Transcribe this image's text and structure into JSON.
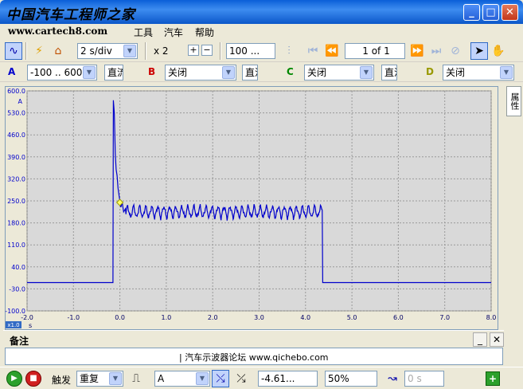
{
  "window": {
    "title": "中国汽车工程师之家",
    "min_label": "_",
    "max_label": "□",
    "close_label": "✕"
  },
  "menubar": {
    "watermark": "www.cartech8.com",
    "items": [
      "工具",
      "汽车",
      "帮助"
    ]
  },
  "toolbar": {
    "timebase": "2 s/div",
    "zoom": "x 2",
    "samples": "100 ...",
    "page": "1 of 1"
  },
  "channels": [
    {
      "letter": "A",
      "color": "#0000cc",
      "range": "-100 .. 600 A",
      "coupling": "直流"
    },
    {
      "letter": "B",
      "color": "#cc0000",
      "range": "关闭",
      "coupling": "直流"
    },
    {
      "letter": "C",
      "color": "#008800",
      "range": "关闭",
      "coupling": "直流"
    },
    {
      "letter": "D",
      "color": "#999900",
      "range": "关闭",
      "coupling": ""
    }
  ],
  "side_tab": "属性",
  "chart_data": {
    "type": "line",
    "y_unit": "A",
    "x_unit": "s",
    "x_scale_label": "x1.0",
    "ylim": [
      -100,
      600
    ],
    "xlim": [
      -2.0,
      8.0
    ],
    "y_ticks": [
      "600.0",
      "530.0",
      "460.0",
      "390.0",
      "320.0",
      "250.0",
      "180.0",
      "110.0",
      "40.0",
      "-30.0",
      "-100.0"
    ],
    "x_ticks": [
      "-2.0",
      "-1.0",
      "0.0",
      "1.0",
      "2.0",
      "3.0",
      "4.0",
      "5.0",
      "6.0",
      "7.0",
      "8.0"
    ],
    "x_tick_values": [
      -2,
      -1,
      0,
      1,
      2,
      3,
      4,
      5,
      6,
      7,
      8
    ],
    "y_tick_values": [
      600,
      530,
      460,
      390,
      320,
      250,
      180,
      110,
      40,
      -30,
      -100
    ],
    "series": [
      {
        "color": "#0000cc",
        "x": [
          -2.0,
          -0.15,
          -0.14,
          -0.12,
          -0.1,
          -0.08,
          -0.06,
          -0.04,
          -0.02,
          0.0,
          0.02,
          0.05,
          0.08,
          0.12,
          4.35,
          4.36,
          4.37,
          8.0
        ],
        "y": [
          -10,
          -10,
          570,
          530,
          400,
          350,
          330,
          290,
          270,
          250,
          230,
          245,
          215,
          225,
          225,
          220,
          -10,
          -10
        ]
      }
    ],
    "ripple": {
      "x_start": 0.1,
      "x_end": 4.35,
      "center": 215,
      "amplitude": 20,
      "period": 0.13
    },
    "trigger_marker": {
      "x": 0.0,
      "y": 245
    }
  },
  "notes": {
    "header": "备注",
    "content": "| 汽车示波器论坛  www.qichebo.com"
  },
  "statusbar": {
    "trigger_label": "触发",
    "mode": "重复",
    "source": "A",
    "level": "-4.61...",
    "percent": "50%",
    "delay": "0 s"
  }
}
